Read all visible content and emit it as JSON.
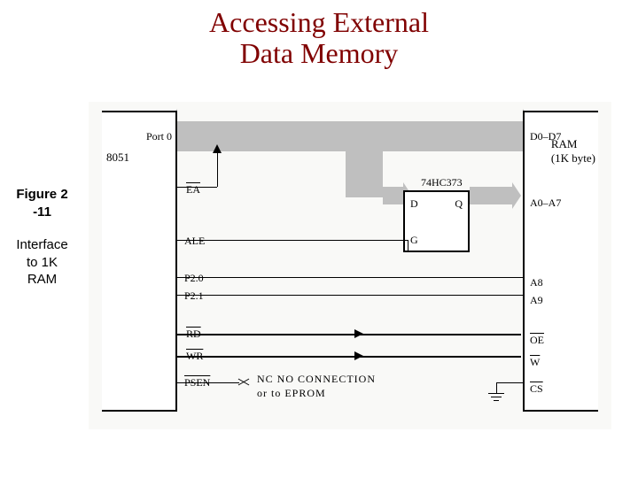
{
  "title": "Accessing External\nData Memory",
  "figure_label": "Figure 2\n-11",
  "caption": "Interface\nto 1K\nRAM",
  "blocks": {
    "left_chip": "8051",
    "latch_chip": "74HC373",
    "right_chip": "RAM\n(1K byte)"
  },
  "pins": {
    "left": {
      "port0": "Port 0",
      "ea": "EA",
      "ale": "ALE",
      "p20": "P2.0",
      "p21": "P2.1",
      "rd": "RD",
      "wr": "WR",
      "psen": "PSEN"
    },
    "latch": {
      "d": "D",
      "q": "Q",
      "g": "G"
    },
    "right": {
      "d0d7": "D0–D7",
      "a0a7": "A0–A7",
      "a8": "A8",
      "a9": "A9",
      "oe": "OE",
      "w": "W",
      "cs": "CS"
    }
  },
  "note": {
    "line1": "NC  NO  CONNECTION",
    "line2": "or  to  EPROM"
  }
}
